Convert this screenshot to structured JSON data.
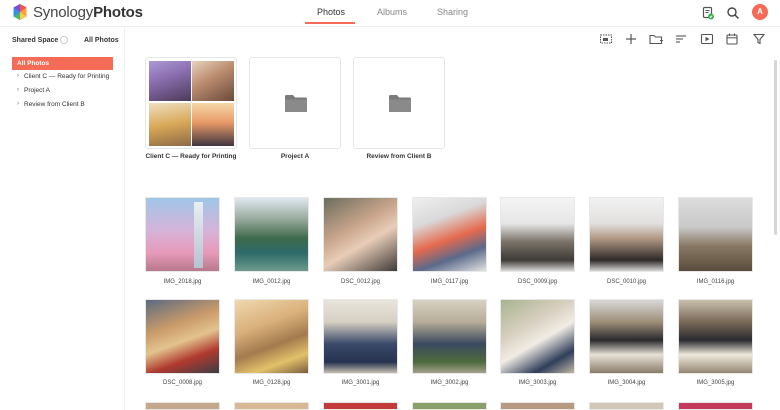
{
  "app": {
    "brand_light": "Synology",
    "brand_bold": "Photos"
  },
  "tabs": [
    {
      "label": "Photos",
      "active": true
    },
    {
      "label": "Albums",
      "active": false
    },
    {
      "label": "Sharing",
      "active": false
    }
  ],
  "user": {
    "initial": "A"
  },
  "colors": {
    "accent": "#f46b57"
  },
  "sidebar": {
    "space_label": "Shared Space",
    "all_photos_link": "All Photos",
    "items": [
      {
        "label": "All Photos",
        "active": true
      },
      {
        "label": "Client C — Ready for Printing",
        "active": false
      },
      {
        "label": "Project A",
        "active": false
      },
      {
        "label": "Review from Client B",
        "active": false
      }
    ]
  },
  "toolbar": {
    "icons": [
      "select-icon",
      "add-icon",
      "add-folder-icon",
      "sort-icon",
      "slideshow-icon",
      "calendar-icon",
      "filter-icon"
    ]
  },
  "albums": [
    {
      "label": "Client C — Ready for Printing",
      "kind": "collage"
    },
    {
      "label": "Project A",
      "kind": "folder"
    },
    {
      "label": "Review from Client B",
      "kind": "folder"
    }
  ],
  "photos": [
    {
      "name": "IMG_2018.jpg"
    },
    {
      "name": "IMG_0012.jpg"
    },
    {
      "name": "DSC_0012.jpg"
    },
    {
      "name": "IMG_0117.jpg"
    },
    {
      "name": "DSC_0009.jpg"
    },
    {
      "name": "DSC_0010.jpg"
    },
    {
      "name": "IMG_0116.jpg"
    },
    {
      "name": "DSC_0008.jpg"
    },
    {
      "name": "IMG_0128.jpg"
    },
    {
      "name": "IMG_3001.jpg"
    },
    {
      "name": "IMG_3002.jpg"
    },
    {
      "name": "IMG_3003.jpg"
    },
    {
      "name": "IMG_3004.jpg"
    },
    {
      "name": "IMG_3005.jpg"
    }
  ]
}
